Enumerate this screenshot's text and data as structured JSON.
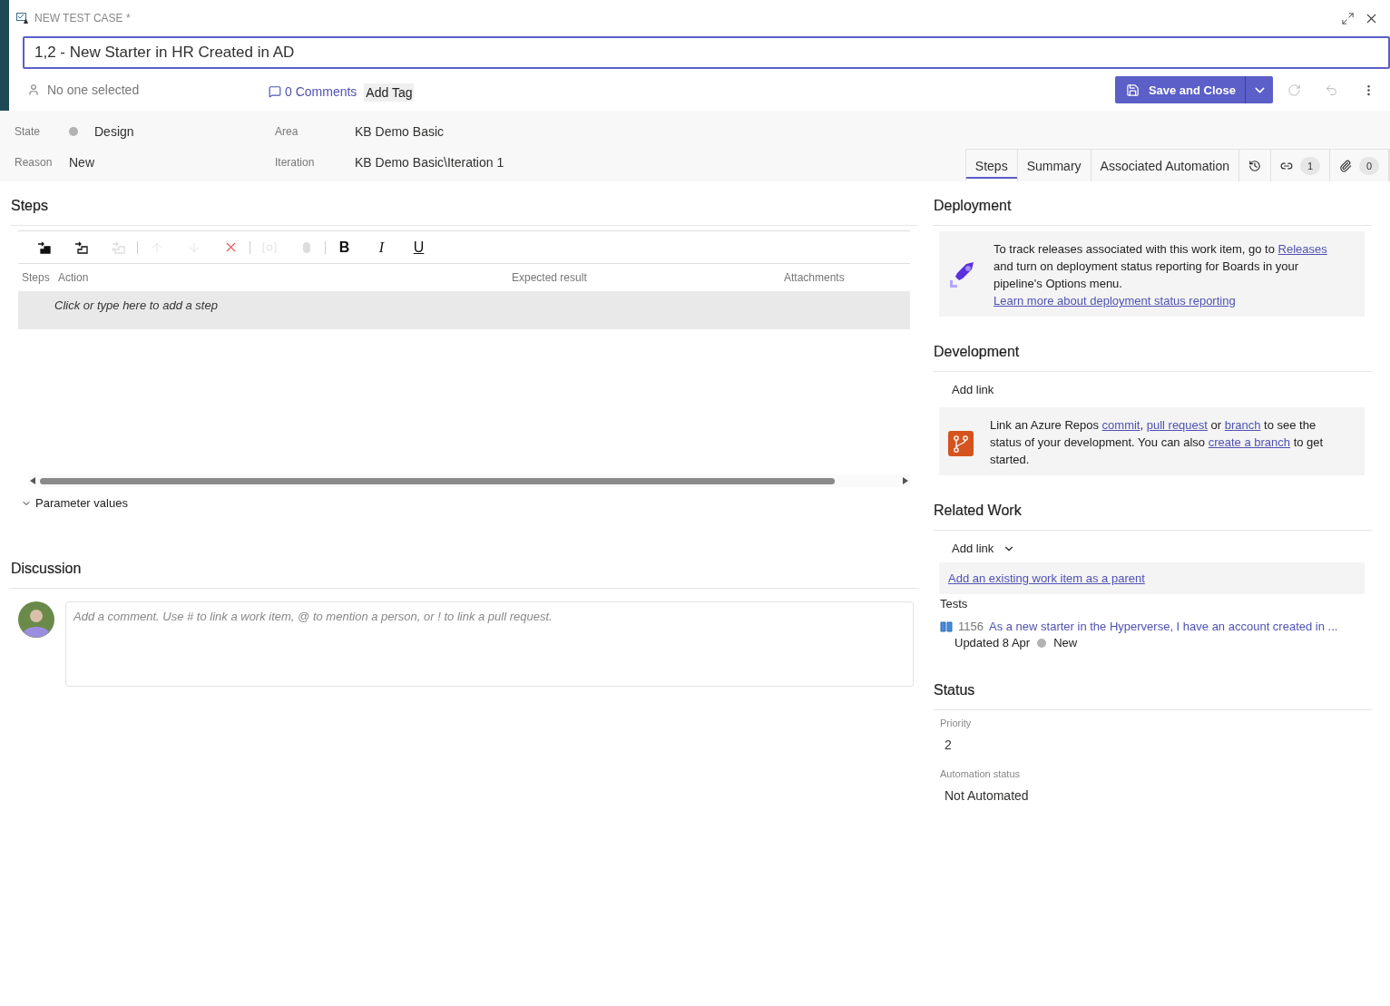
{
  "window": {
    "type_label": "NEW TEST CASE *",
    "title": "1,2 - New Starter in HR Created in AD"
  },
  "header": {
    "assigned": "No one selected",
    "comments": "0 Comments",
    "add_tag": "Add Tag",
    "save_button": "Save and Close"
  },
  "fields": [
    {
      "label": "State",
      "value": "Design",
      "color": "#b2b2b2"
    },
    {
      "label": "Reason",
      "value": "New"
    },
    {
      "label": "Area",
      "value": "KB Demo Basic"
    },
    {
      "label": "Iteration",
      "value": "KB Demo Basic\\Iteration 1"
    }
  ],
  "tabs": [
    {
      "kind": "text",
      "label": "Steps",
      "selected": true
    },
    {
      "kind": "text",
      "label": "Summary",
      "selected": false
    },
    {
      "kind": "text",
      "label": "Associated Automation",
      "selected": false
    },
    {
      "kind": "history",
      "selected": false
    },
    {
      "kind": "links",
      "count": "1",
      "selected": false
    },
    {
      "kind": "attachments",
      "count": "0",
      "selected": false
    }
  ],
  "steps": {
    "title": "Steps",
    "toolbar": [
      {
        "kind": "insert-step",
        "disabled": false
      },
      {
        "kind": "insert-shared",
        "disabled": false
      },
      {
        "kind": "create-shared",
        "disabled": true
      },
      {
        "kind": "separator"
      },
      {
        "kind": "up",
        "disabled": true
      },
      {
        "kind": "down",
        "disabled": true
      },
      {
        "kind": "delete",
        "disabled": false
      },
      {
        "kind": "separator"
      },
      {
        "kind": "parameter",
        "disabled": true
      },
      {
        "kind": "attach",
        "disabled": true
      },
      {
        "kind": "separator"
      },
      {
        "kind": "bold",
        "label": "B",
        "disabled": false
      },
      {
        "kind": "italic",
        "label": "I",
        "disabled": false
      },
      {
        "kind": "underline",
        "label": "U",
        "disabled": false
      }
    ],
    "columns": [
      "Steps",
      "Action",
      "Expected result",
      "Attachments"
    ],
    "placeholder": "Click or type here to add a step",
    "parameter_values": "Parameter values"
  },
  "discussion": {
    "title": "Discussion",
    "placeholder": "Add a comment. Use # to link a work item, @ to mention a person, or ! to link a pull request."
  },
  "deployment": {
    "title": "Deployment",
    "message": [
      {
        "kind": "text",
        "text": "To track releases associated with this work item, go to "
      },
      {
        "kind": "link",
        "text": "Releases"
      },
      {
        "kind": "text",
        "text": " and turn on deployment status reporting for Boards in your pipeline's Options menu. "
      },
      {
        "kind": "link",
        "text": "Learn more about deployment status reporting"
      }
    ]
  },
  "development": {
    "title": "Development",
    "add_link": "Add link",
    "message": [
      {
        "kind": "text",
        "text": "Link an Azure Repos "
      },
      {
        "kind": "link",
        "text": "commit"
      },
      {
        "kind": "text",
        "text": ", "
      },
      {
        "kind": "link",
        "text": "pull request"
      },
      {
        "kind": "text",
        "text": " or "
      },
      {
        "kind": "link",
        "text": "branch"
      },
      {
        "kind": "text",
        "text": " to see the status of your development. You can also "
      },
      {
        "kind": "link",
        "text": "create a branch"
      },
      {
        "kind": "text",
        "text": " to get started."
      }
    ]
  },
  "related_work": {
    "title": "Related Work",
    "add_link": "Add link",
    "parent_link": "Add an existing work item as a parent",
    "group": "Tests",
    "items": [
      {
        "id": "1156",
        "title": "As a new starter in the Hyperverse, I have an account created in ...",
        "updated": "Updated 8 Apr",
        "state": "New",
        "color": "#b2b2b2"
      }
    ]
  },
  "status": {
    "title": "Status",
    "fields": [
      {
        "label": "Priority",
        "value": "2"
      },
      {
        "label": "Automation status",
        "value": "Not Automated"
      }
    ]
  }
}
